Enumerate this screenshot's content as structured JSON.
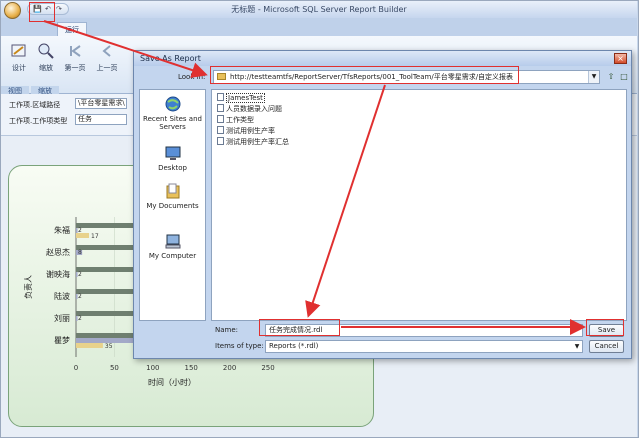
{
  "window": {
    "title": "无标题 - Microsoft SQL Server Report Builder"
  },
  "ribbon": {
    "tab_run": "运行",
    "design_label": "设计",
    "zoom_label": "缩放",
    "first_page_label": "第一页",
    "prev_page_label": "上一页",
    "group_view": "视图",
    "group_zoom": "缩放"
  },
  "params": {
    "param1_label": "工作项.区域路径",
    "param1_value": "\\平台零星需求\\",
    "param2_label": "工作项.工作项类型",
    "param2_value": "任务"
  },
  "dialog": {
    "title": "Save As Report",
    "look_in_label": "Look in:",
    "look_in_value": "http://testteamtfs/ReportServer/TfsReports/001_ToolTeam/平台零星需求/自定义报表",
    "places": [
      "Recent Sites and Servers",
      "Desktop",
      "My Documents",
      "My Computer"
    ],
    "files": [
      "JamesTest",
      "人员数据录入问题",
      "工作类型",
      "测试用例生产率",
      "测试用例生产率汇总"
    ],
    "name_label": "Name:",
    "name_value": "任务完成情况.rdl",
    "type_label": "Items of type:",
    "type_value": "Reports (*.rdl)",
    "save_label": "Save",
    "cancel_label": "Cancel"
  },
  "chart_data": {
    "type": "bar",
    "categories": [
      "朱福",
      "赵思杰",
      "谢映海",
      "陆波",
      "刘丽",
      "瞿梦"
    ],
    "series": [
      {
        "color": "#e8d28c",
        "values": [
          17,
          null,
          null,
          null,
          null,
          35
        ]
      },
      {
        "color": "#a3a9c8",
        "values": [
          2,
          8,
          2,
          2,
          2,
          161
        ]
      },
      {
        "color": "#6f7f70",
        "values": [
          130,
          120,
          130,
          130,
          130,
          160
        ]
      }
    ],
    "data_labels": [
      "17",
      "2",
      "8",
      "2",
      "2",
      "2",
      "35",
      "161"
    ],
    "xlabel": "时间（小时）",
    "ylabel": "负责人",
    "xticks": [
      "0",
      "50",
      "100",
      "150",
      "200",
      "250"
    ],
    "xlim": [
      0,
      250
    ]
  },
  "colors": {
    "annotation": "#e03030",
    "ribbon_bg": "#d9e5f4",
    "dialog_bg": "#c3d5ee"
  }
}
